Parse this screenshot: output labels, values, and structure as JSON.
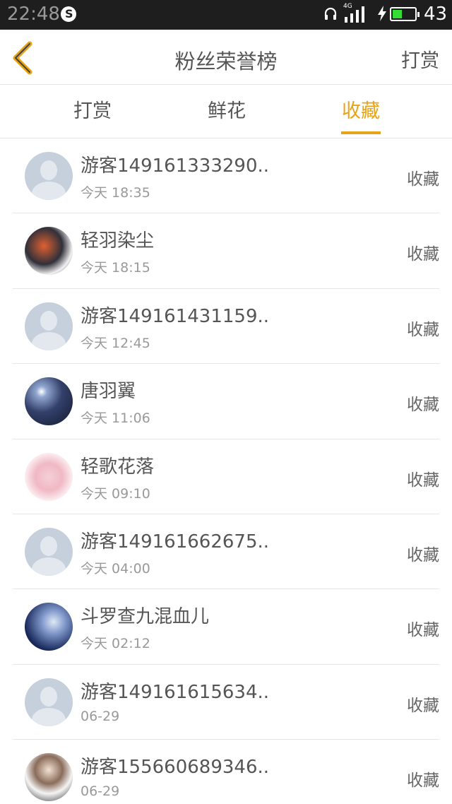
{
  "status_bar": {
    "time": "22:48",
    "network": "4G",
    "battery_pct": "43",
    "battery_level": 0.43,
    "icons": [
      "notification-icon",
      "headphone-icon",
      "signal-icon",
      "charging-icon",
      "battery-icon"
    ]
  },
  "header": {
    "title": "粉丝荣誉榜",
    "right_action": "打赏"
  },
  "tabs": [
    {
      "label": "打赏",
      "active": false
    },
    {
      "label": "鲜花",
      "active": false
    },
    {
      "label": "收藏",
      "active": true
    }
  ],
  "colors": {
    "accent": "#e8a317",
    "text": "#555555",
    "muted": "#999999"
  },
  "rows": [
    {
      "name": "游客149161333290..",
      "time": "今天 18:35",
      "action": "收藏",
      "avatar": "guest-avatar"
    },
    {
      "name": "轻羽染尘",
      "time": "今天 18:15",
      "action": "收藏",
      "avatar": "user-avatar"
    },
    {
      "name": "游客149161431159..",
      "time": "今天 12:45",
      "action": "收藏",
      "avatar": "guest-avatar"
    },
    {
      "name": "唐羽翼",
      "time": "今天 11:06",
      "action": "收藏",
      "avatar": "user-avatar"
    },
    {
      "name": "轻歌花落",
      "time": "今天 09:10",
      "action": "收藏",
      "avatar": "user-avatar"
    },
    {
      "name": "游客149161662675..",
      "time": "今天 04:00",
      "action": "收藏",
      "avatar": "guest-avatar"
    },
    {
      "name": "斗罗查九混血儿",
      "time": "今天 02:12",
      "action": "收藏",
      "avatar": "user-avatar"
    },
    {
      "name": "游客149161615634..",
      "time": "06-29",
      "action": "收藏",
      "avatar": "guest-avatar"
    },
    {
      "name": "游客155660689346..",
      "time": "06-29",
      "action": "收藏",
      "avatar": "user-avatar"
    }
  ]
}
